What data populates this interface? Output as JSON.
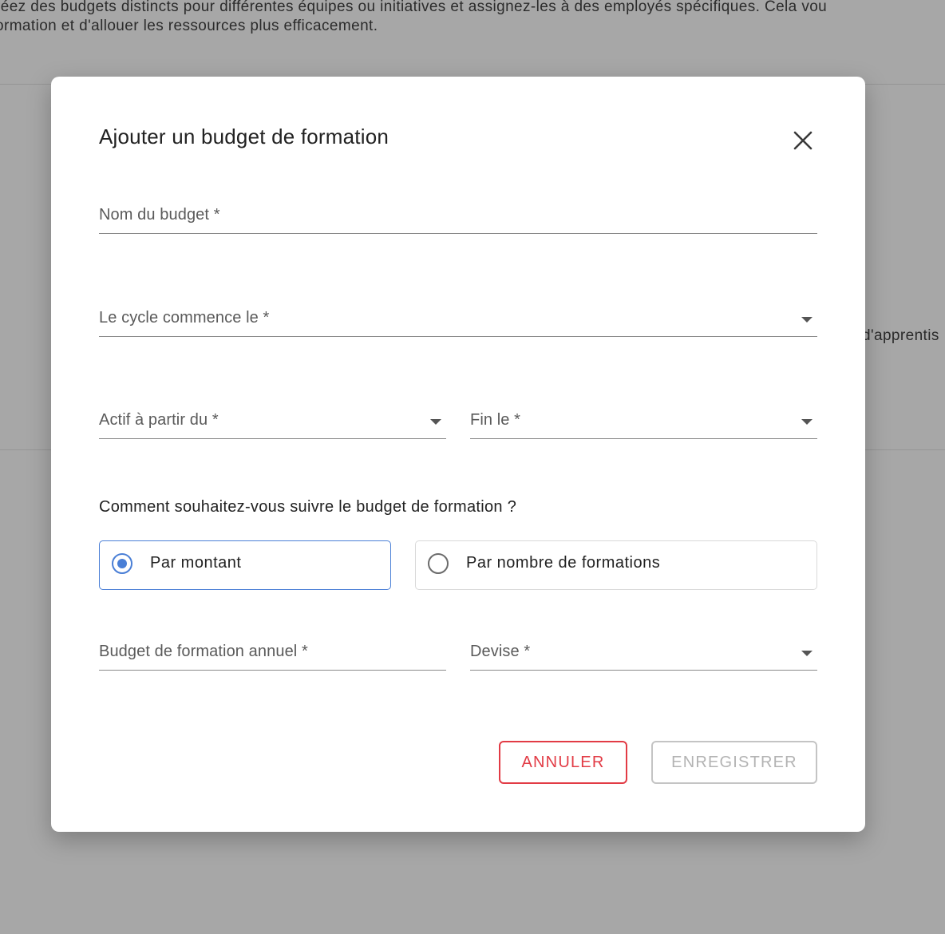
{
  "background": {
    "line1": "réez des budgets distincts pour différentes équipes ou initiatives et assignez-les à des employés spécifiques. Cela vou",
    "line2": "ormation et d'allouer les ressources plus efficacement.",
    "side_text": "d'apprentis"
  },
  "dialog": {
    "title": "Ajouter un budget de formation",
    "fields": {
      "budget_name": {
        "label": "Nom du budget *",
        "value": ""
      },
      "cycle_start": {
        "label": "Le cycle commence le *",
        "value": ""
      },
      "active_from": {
        "label": "Actif à partir du *",
        "value": ""
      },
      "end_date": {
        "label": "Fin le *",
        "value": ""
      },
      "annual_budget": {
        "label": "Budget de formation annuel *",
        "value": ""
      },
      "currency": {
        "label": "Devise *",
        "value": ""
      }
    },
    "tracking_question": "Comment souhaitez-vous suivre le budget de formation ?",
    "tracking_options": [
      {
        "label": "Par montant",
        "selected": true
      },
      {
        "label": "Par nombre de formations",
        "selected": false
      }
    ],
    "buttons": {
      "cancel": "ANNULER",
      "save": "ENREGISTRER"
    }
  },
  "colors": {
    "accent": "#4a7fd6",
    "danger": "#e23b45",
    "disabled": "#b3b3b3",
    "overlay": "#a7a7a7"
  }
}
